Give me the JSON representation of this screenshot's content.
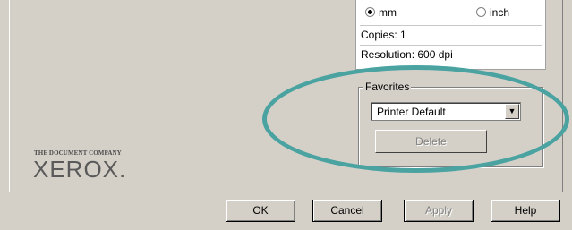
{
  "units": {
    "mm_label": "mm",
    "inch_label": "inch",
    "selected": "mm"
  },
  "info": {
    "copies": "Copies: 1",
    "resolution": "Resolution: 600 dpi"
  },
  "favorites": {
    "legend": "Favorites",
    "selected": "Printer Default",
    "delete_label": "Delete"
  },
  "logo": {
    "tagline": "THE DOCUMENT COMPANY",
    "brand": "XEROX."
  },
  "buttons": {
    "ok": "OK",
    "cancel": "Cancel",
    "apply": "Apply",
    "help": "Help"
  },
  "colors": {
    "annotation": "#4aa3a1",
    "dialog_bg": "#d4d0c8"
  }
}
